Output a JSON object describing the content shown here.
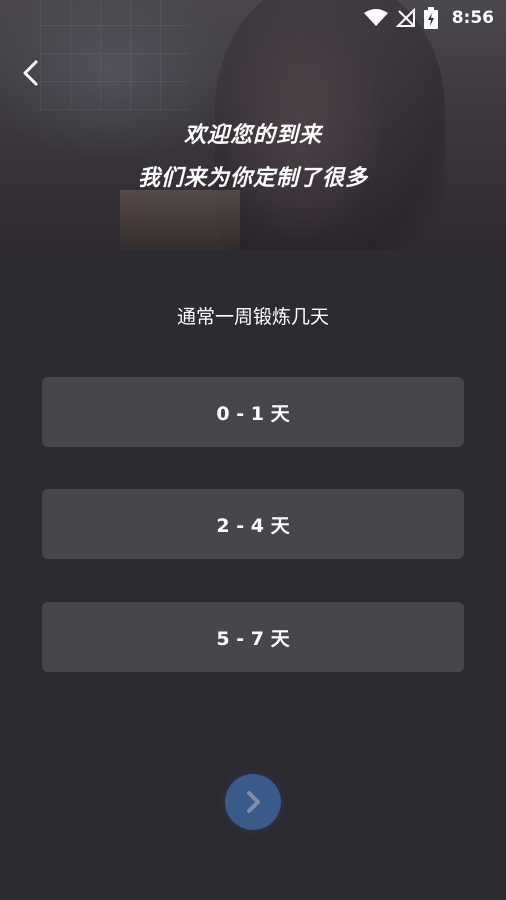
{
  "status_bar": {
    "time": "8:56"
  },
  "hero": {
    "line1": "欢迎您的到来",
    "line2": "我们来为你定制了很多"
  },
  "question": "通常一周锻炼几天",
  "options": [
    {
      "label": "0 - 1 天"
    },
    {
      "label": "2 - 4 天"
    },
    {
      "label": "5 - 7 天"
    }
  ],
  "icons": {
    "back": "chevron-left-icon",
    "next": "chevron-right-icon",
    "wifi": "wifi-icon",
    "signal": "no-signal-icon",
    "battery": "battery-charging-icon"
  },
  "colors": {
    "background": "#2d2a30",
    "option_bg": "#48464b",
    "next_button": "#3a5a8c"
  }
}
